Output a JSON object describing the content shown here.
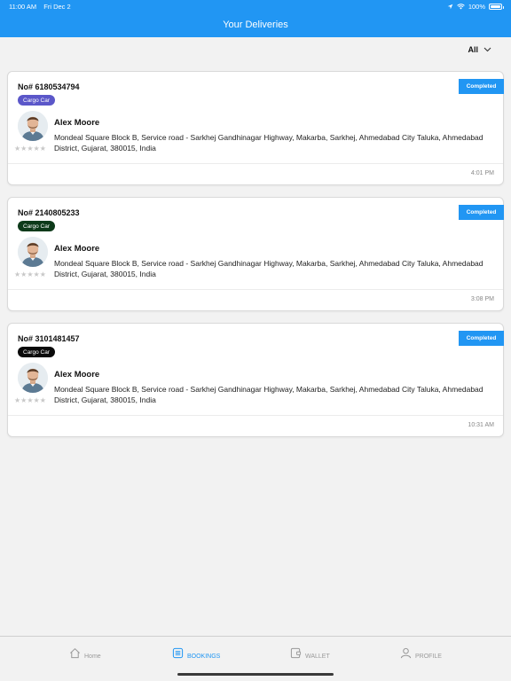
{
  "status_bar": {
    "time": "11:00 AM",
    "date": "Fri Dec 2",
    "battery": "100%"
  },
  "header": {
    "title": "Your Deliveries"
  },
  "filter": {
    "label": "All"
  },
  "deliveries": [
    {
      "order_no": "No# 6180534794",
      "vehicle": "Cargo Car",
      "vehicle_color": "#5b57c9",
      "status": "Completed",
      "driver_name": "Alex Moore",
      "address": "Mondeal Square Block B, Service road - Sarkhej Gandhinagar Highway, Makarba, Sarkhej, Ahmedabad City Taluka, Ahmedabad District, Gujarat, 380015, India",
      "stars": "★★★★★",
      "time": "4:01 PM"
    },
    {
      "order_no": "No# 2140805233",
      "vehicle": "Cargo Car",
      "vehicle_color": "#0d3a1a",
      "status": "Completed",
      "driver_name": "Alex Moore",
      "address": "Mondeal Square Block B, Service road - Sarkhej Gandhinagar Highway, Makarba, Sarkhej, Ahmedabad City Taluka, Ahmedabad District, Gujarat, 380015, India",
      "stars": "★★★★★",
      "time": "3:08 PM"
    },
    {
      "order_no": "No# 3101481457",
      "vehicle": "Cargo Car",
      "vehicle_color": "#0a0a0a",
      "status": "Completed",
      "driver_name": "Alex Moore",
      "address": "Mondeal Square Block B, Service road - Sarkhej Gandhinagar Highway, Makarba, Sarkhej, Ahmedabad City Taluka, Ahmedabad District, Gujarat, 380015, India",
      "stars": "★★★★★",
      "time": "10:31 AM"
    }
  ],
  "nav": {
    "home": "Home",
    "bookings": "BOOKINGS",
    "wallet": "WALLET",
    "profile": "PROFILE"
  },
  "colors": {
    "accent": "#2196f3",
    "background": "#f2f2f2"
  }
}
